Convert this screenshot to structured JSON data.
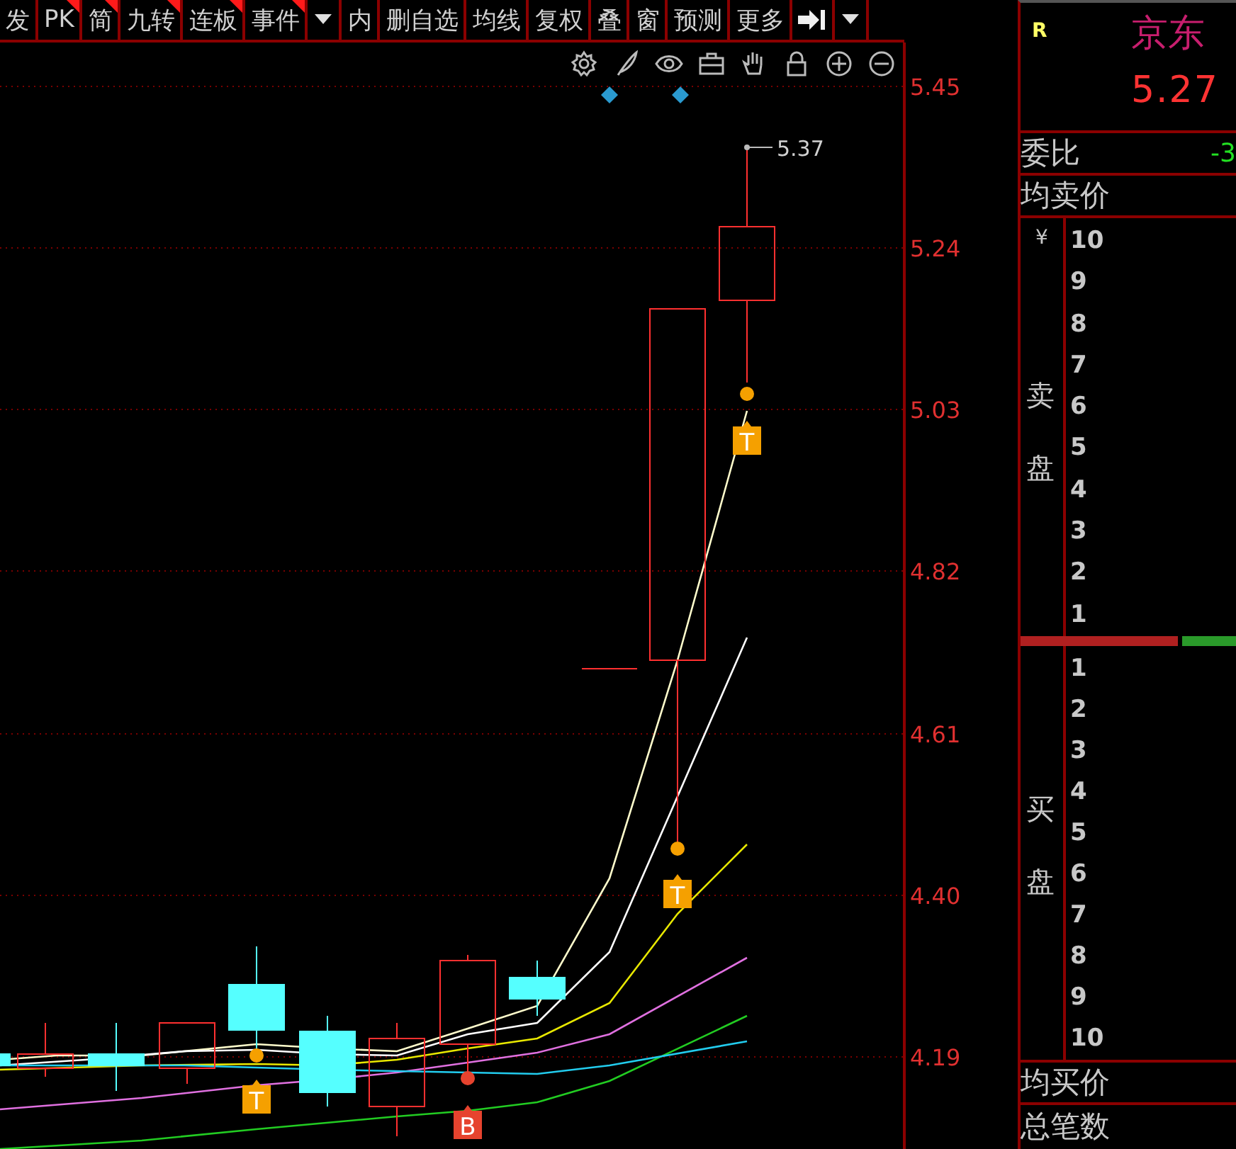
{
  "toolbar": {
    "items": [
      {
        "kind": "text",
        "label": "发",
        "flagged": false
      },
      {
        "kind": "text",
        "label": "PK",
        "flagged": true
      },
      {
        "kind": "text",
        "label": "简",
        "flagged": true
      },
      {
        "kind": "text",
        "label": "九转",
        "flagged": true
      },
      {
        "kind": "text",
        "label": "连板",
        "flagged": true
      },
      {
        "kind": "text",
        "label": "事件",
        "flagged": true
      },
      {
        "kind": "dropdown",
        "flagged": false
      },
      {
        "kind": "text",
        "label": "内",
        "flagged": false
      },
      {
        "kind": "text",
        "label": "删自选",
        "flagged": false
      },
      {
        "kind": "text",
        "label": "均线",
        "flagged": false
      },
      {
        "kind": "text",
        "label": "复权",
        "flagged": false
      },
      {
        "kind": "text",
        "label": "叠",
        "flagged": false
      },
      {
        "kind": "text",
        "label": "窗",
        "flagged": false
      },
      {
        "kind": "text",
        "label": "预测",
        "flagged": false
      },
      {
        "kind": "text",
        "label": "更多",
        "flagged": false
      },
      {
        "kind": "collapse",
        "flagged": false
      },
      {
        "kind": "dropdown",
        "flagged": false
      }
    ]
  },
  "chart": {
    "price_ticks": [
      "5.45",
      "5.24",
      "5.03",
      "4.82",
      "4.61",
      "4.40",
      "4.19"
    ],
    "high_label": "5.37",
    "markers": [
      {
        "letter": "T",
        "color": "#f5a000"
      },
      {
        "letter": "B",
        "color": "#e6432e"
      },
      {
        "letter": "T",
        "color": "#f5a000"
      },
      {
        "letter": "T",
        "color": "#f5a000"
      }
    ]
  },
  "quote": {
    "flag": "R",
    "stock_name": "京东",
    "price": "5.27",
    "ratio": {
      "label": "委比",
      "value": "-3"
    },
    "avg_sell": {
      "label": "均卖价"
    },
    "sell_book": {
      "currency": "¥",
      "label": "卖盘",
      "levels": [
        "10",
        "9",
        "8",
        "7",
        "6",
        "5",
        "4",
        "3",
        "2",
        "1"
      ]
    },
    "balance_bar": {
      "level": 0.73
    },
    "buy_book": {
      "label": "买盘",
      "levels": [
        "1",
        "2",
        "3",
        "4",
        "5",
        "6",
        "7",
        "8",
        "9",
        "10"
      ]
    },
    "avg_buy": {
      "label": "均买价"
    },
    "total_trades": {
      "label": "总笔数"
    }
  }
}
